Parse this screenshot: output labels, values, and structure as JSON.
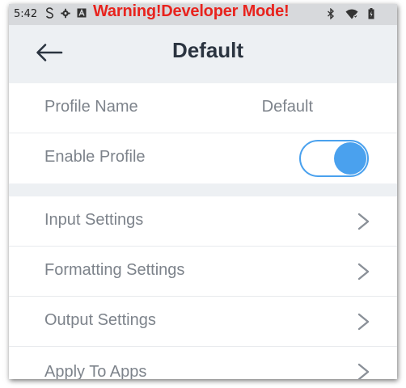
{
  "status_bar": {
    "time": "5:42",
    "left_icons": [
      "sync-s-icon",
      "gear-icon",
      "a-box-icon"
    ],
    "warning_text": "Warning!Developer Mode!",
    "right_icons": [
      "bluetooth-icon",
      "wifi-icon",
      "battery-icon"
    ],
    "warning_color": "#e8231d"
  },
  "app_bar": {
    "back_icon": "arrow-left-icon",
    "title": "Default"
  },
  "profile": {
    "name_label": "Profile Name",
    "name_value": "Default",
    "enable_label": "Enable Profile",
    "enabled": true
  },
  "settings": {
    "items": [
      {
        "label": "Input Settings"
      },
      {
        "label": "Formatting Settings"
      },
      {
        "label": "Output Settings"
      },
      {
        "label": "Apply To Apps"
      }
    ]
  },
  "colors": {
    "accent": "#4aa1ee",
    "app_bar_bg": "#edf0f3",
    "label_text": "#7d838b",
    "title_text": "#2b3440"
  }
}
